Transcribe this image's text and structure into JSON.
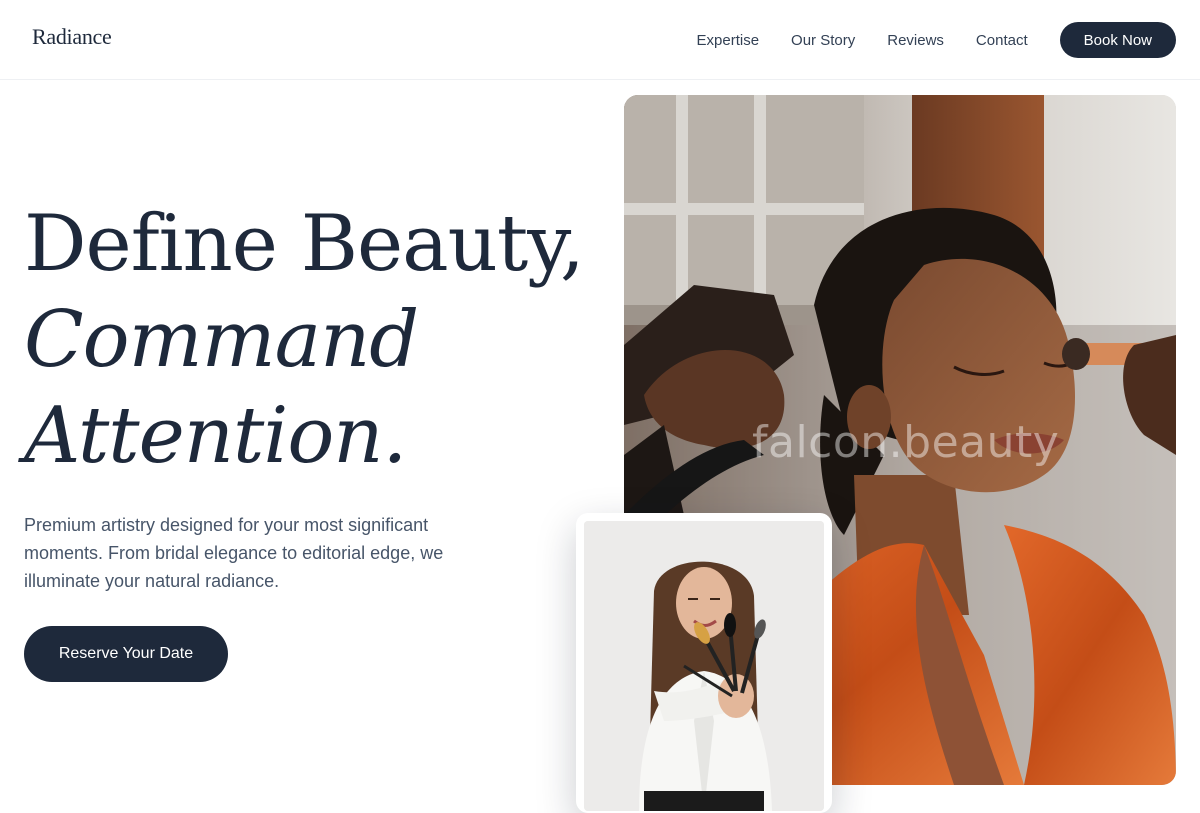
{
  "brand": {
    "logo_text": "Radiance"
  },
  "nav": {
    "links": [
      "Expertise",
      "Our Story",
      "Reviews",
      "Contact"
    ],
    "cta_label": "Book Now"
  },
  "hero": {
    "headline_line1": "Define Beauty,",
    "headline_line2": "Command",
    "headline_line3": "Attention.",
    "description": "Premium artistry designed for your most significant moments. From bridal elegance to editorial edge, we illuminate your natural radiance.",
    "cta_label": "Reserve Your Date",
    "image_watermark": "falcon.beauty"
  },
  "colors": {
    "navy": "#1e293b",
    "body_text": "#475569",
    "accent_orange": "#d4561f",
    "background": "#ffffff"
  },
  "icons": {
    "main_image": "makeup-artist-applying-bronzer-photo",
    "inset_image": "woman-holding-makeup-brushes-photo"
  }
}
